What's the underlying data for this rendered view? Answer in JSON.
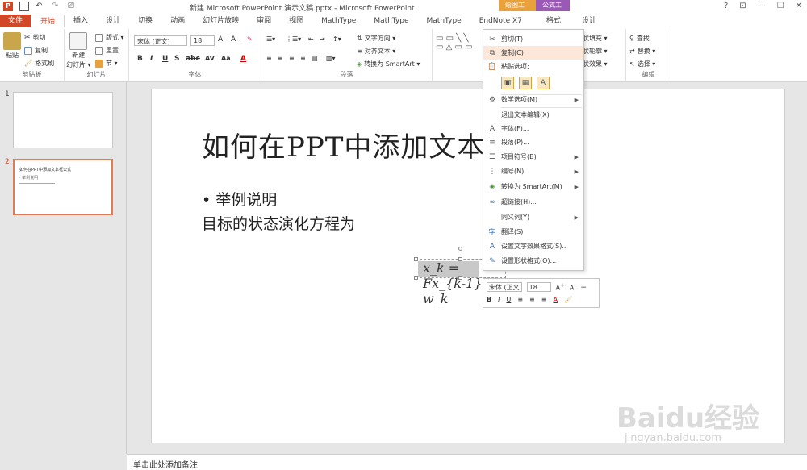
{
  "titlebar": {
    "title": "新建 Microsoft PowerPoint 演示文稿.pptx - Microsoft PowerPoint",
    "context_draw": "绘图工具",
    "context_formula": "公式工具",
    "win_help": "?",
    "win_restore": "⊡",
    "win_min": "—",
    "win_max": "☐",
    "win_close": "✕"
  },
  "tabs": [
    "文件",
    "开始",
    "插入",
    "设计",
    "切换",
    "动画",
    "幻灯片放映",
    "审阅",
    "视图",
    "MathType",
    "MathType",
    "MathType",
    "EndNote X7",
    "格式",
    "设计"
  ],
  "ribbon": {
    "paste": "粘贴",
    "cut": "剪切",
    "copy": "复制",
    "format_painter": "格式刷",
    "clipboard_group": "剪贴板",
    "new_slide_1": "新建",
    "new_slide_2": "幻灯片 ▾",
    "layout": "版式 ▾",
    "reset": "重置",
    "section": "节 ▾",
    "slides_group": "幻灯片",
    "font_name": "宋体 (正文)",
    "font_size": "18",
    "font_group": "字体",
    "text_direction": "文字方向 ▾",
    "align_text": "对齐文本 ▾",
    "convert_smartart": "转换为 SmartArt ▾",
    "paragraph_group": "段落",
    "shape_fill": "状填充 ▾",
    "shape_outline": "状轮廓 ▾",
    "shape_effects": "状效果 ▾",
    "find": "查找",
    "replace": "替换 ▾",
    "select": "选择 ▾",
    "edit_group": "编辑"
  },
  "thumbs": {
    "n1": "1",
    "n2": "2",
    "t2_title": "如何在PPT中添加文本框公式",
    "t2_line": "· 举例说明"
  },
  "slide": {
    "title": "如何在PPT中添加文本框公式",
    "bullet": "• 举例说明",
    "body": "目标的状态演化方程为",
    "equation": "x_k = Fx_{k-1} + w_k"
  },
  "context_menu": {
    "cut": "剪切(T)",
    "copy": "复制(C)",
    "paste_options": "粘贴选项:",
    "number_options": "数学选项(M)",
    "exit_text_edit": "退出文本编辑(X)",
    "font": "字体(F)...",
    "paragraph": "段落(P)...",
    "bullets": "项目符号(B)",
    "numbering": "编号(N)",
    "convert_smartart": "转换为 SmartArt(M)",
    "hyperlink": "超链接(H)...",
    "synonyms": "同义词(Y)",
    "translate": "翻译(S)",
    "format_text_effects": "设置文字效果格式(S)...",
    "format_shape": "设置形状格式(O)..."
  },
  "mini_toolbar": {
    "font_name": "宋体 (正文",
    "font_size": "18"
  },
  "notes": "单击此处添加备注",
  "watermark": {
    "brand": "Baidu经验",
    "url": "jingyan.baidu.com"
  },
  "colors": {
    "accent": "#d24726",
    "highlight": "#fde7d9",
    "draw_tools": "#e9a23b",
    "formula_tools": "#9b59b6"
  }
}
